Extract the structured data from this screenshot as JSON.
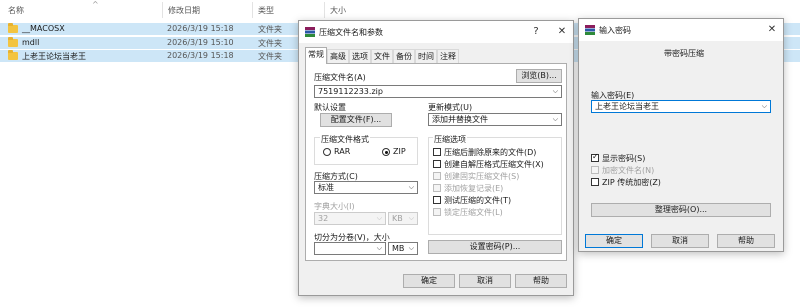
{
  "explorer": {
    "columns": {
      "name": "名称",
      "modified": "修改日期",
      "type": "类型",
      "size": "大小"
    },
    "files": [
      {
        "name": "__MACOSX",
        "modified": "2026/3/19 15:18",
        "type": "文件夹"
      },
      {
        "name": "mdll",
        "modified": "2026/3/19 15:10",
        "type": "文件夹"
      },
      {
        "name": "上老王论坛当老王",
        "modified": "2026/3/19 15:18",
        "type": "文件夹"
      }
    ]
  },
  "archive_dialog": {
    "title": "压缩文件名和参数",
    "help_glyph": "?",
    "close_glyph": "✕",
    "tabs": [
      "常规",
      "高级",
      "选项",
      "文件",
      "备份",
      "时间",
      "注释"
    ],
    "archive_name_label": "压缩文件名(A)",
    "browse_button": "浏览(B)...",
    "archive_name_value": "7519112233.zip",
    "default_settings_label": "默认设置",
    "profiles_button": "配置文件(F)...",
    "update_mode_label": "更新模式(U)",
    "update_mode_value": "添加并替换文件",
    "format_group_label": "压缩文件格式",
    "format_rar": "RAR",
    "format_zip": "ZIP",
    "options_group_label": "压缩选项",
    "options": [
      {
        "label": "压缩后删除原来的文件(D)",
        "checked": false,
        "enabled": true
      },
      {
        "label": "创建自解压格式压缩文件(X)",
        "checked": false,
        "enabled": true
      },
      {
        "label": "创建固实压缩文件(S)",
        "checked": false,
        "enabled": false
      },
      {
        "label": "添加恢复记录(E)",
        "checked": false,
        "enabled": false
      },
      {
        "label": "测试压缩的文件(T)",
        "checked": false,
        "enabled": true
      },
      {
        "label": "锁定压缩文件(L)",
        "checked": false,
        "enabled": false
      }
    ],
    "method_label": "压缩方式(C)",
    "method_value": "标准",
    "dict_label": "字典大小(I)",
    "dict_value": "32",
    "dict_unit": "KB",
    "split_label": "切分为分卷(V)，大小",
    "split_value": "",
    "split_unit": "MB",
    "set_password_button": "设置密码(P)...",
    "ok_button": "确定",
    "cancel_button": "取消",
    "help_button": "帮助"
  },
  "password_dialog": {
    "title": "输入密码",
    "close_glyph": "✕",
    "heading": "带密码压缩",
    "password_label": "输入密码(E)",
    "password_value": "上老王论坛当老王",
    "show_password_label": "显示密码(S)",
    "show_password_checked": true,
    "encrypt_names_label": "加密文件名(N)",
    "encrypt_names_checked": false,
    "zip_legacy_label": "ZIP 传统加密(Z)",
    "zip_legacy_checked": false,
    "organize_button": "整理密码(O)...",
    "ok_button": "确定",
    "cancel_button": "取消",
    "help_button": "帮助"
  },
  "colors": {
    "selection": "#cde6f7",
    "dialog_bg": "#f0f0f0",
    "accent": "#0078d7",
    "folder": "#f3c440"
  }
}
